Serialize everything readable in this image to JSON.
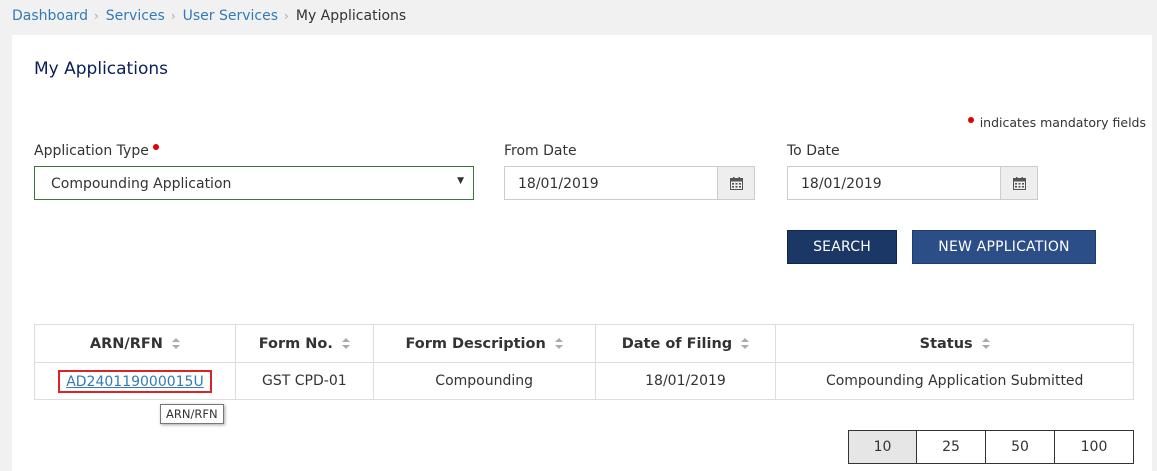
{
  "breadcrumb": {
    "items": [
      "Dashboard",
      "Services",
      "User Services"
    ],
    "current": "My Applications",
    "separator": "›"
  },
  "page": {
    "title": "My Applications",
    "mandatory_note": "indicates mandatory fields"
  },
  "form": {
    "application_type": {
      "label": "Application Type",
      "value": "Compounding Application"
    },
    "from_date": {
      "label": "From Date",
      "value": "18/01/2019"
    },
    "to_date": {
      "label": "To Date",
      "value": "18/01/2019"
    }
  },
  "buttons": {
    "search": "SEARCH",
    "new_application": "NEW APPLICATION"
  },
  "table": {
    "columns": [
      "ARN/RFN",
      "Form No.",
      "Form Description",
      "Date of Filing",
      "Status"
    ],
    "rows": [
      [
        "AD240119000015U",
        "GST CPD-01",
        "Compounding",
        "18/01/2019",
        "Compounding Application Submitted"
      ]
    ]
  },
  "tooltip": "ARN/RFN",
  "pagination": {
    "sizes": [
      "10",
      "25",
      "50",
      "100"
    ],
    "selected": "10"
  },
  "icons": {
    "calendar": "calendar-icon",
    "sort": "sort-icon",
    "dropdown": "chevron-down-icon"
  },
  "colors": {
    "link": "#337ab7",
    "primary_button": "#1b3766",
    "secondary_button": "#2c4e86",
    "required": "#e00000",
    "highlight": "#d9252a"
  }
}
